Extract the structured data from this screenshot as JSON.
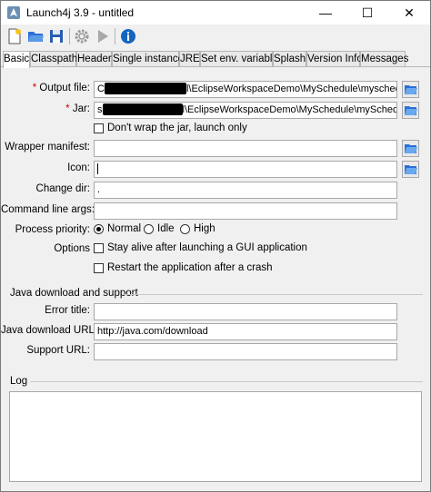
{
  "window": {
    "title": "Launch4j 3.9 - untitled",
    "controls": {
      "minimize": "—",
      "maximize": "☐",
      "close": "✕"
    }
  },
  "toolbar": {
    "icons": [
      "new-file-icon",
      "open-folder-icon",
      "save-icon",
      "gear-icon",
      "play-icon",
      "info-icon"
    ]
  },
  "tabs": [
    {
      "label": "Basic",
      "active": true
    },
    {
      "label": "Classpath",
      "active": false
    },
    {
      "label": "Header",
      "active": false
    },
    {
      "label": "Single instance",
      "active": false
    },
    {
      "label": "JRE",
      "active": false
    },
    {
      "label": "Set env. variables",
      "active": false
    },
    {
      "label": "Splash",
      "active": false
    },
    {
      "label": "Version Info",
      "active": false
    },
    {
      "label": "Messages",
      "active": false
    }
  ],
  "basic": {
    "required_mark": "*",
    "output_file": {
      "label": "Output file:",
      "value_prefix": "C",
      "value": "l\\EclipseWorkspaceDemo\\MySchedule\\myschedule.exe"
    },
    "jar": {
      "label": "Jar:",
      "value_prefix": "s",
      "value": "l\\EclipseWorkspaceDemo\\MySchedule\\mySchedule.jar"
    },
    "dont_wrap": {
      "label": "Don't wrap the jar, launch only",
      "checked": false
    },
    "wrapper_manifest": {
      "label": "Wrapper manifest:",
      "value": ""
    },
    "icon": {
      "label": "Icon:",
      "value": ""
    },
    "change_dir": {
      "label": "Change dir:",
      "value": "."
    },
    "cmd_args": {
      "label": "Command line args:",
      "value": ""
    },
    "process_priority": {
      "label": "Process priority:",
      "options": [
        "Normal",
        "Idle",
        "High"
      ],
      "selected": "Normal"
    },
    "options": {
      "label": "Options",
      "stay_alive": {
        "label": "Stay alive after launching a GUI application",
        "checked": false
      },
      "restart": {
        "label": "Restart the application after a crash",
        "checked": false
      }
    },
    "java_download": {
      "section_title": "Java download and support",
      "error_title": {
        "label": "Error title:",
        "value": ""
      },
      "download_url": {
        "label": "Java download URL:",
        "value": "http://java.com/download"
      },
      "support_url": {
        "label": "Support URL:",
        "value": ""
      }
    }
  },
  "log": {
    "title": "Log",
    "content": ""
  },
  "colors": {
    "required": "#d00000",
    "folder": "#2b6fd6",
    "info": "#1565c0"
  }
}
